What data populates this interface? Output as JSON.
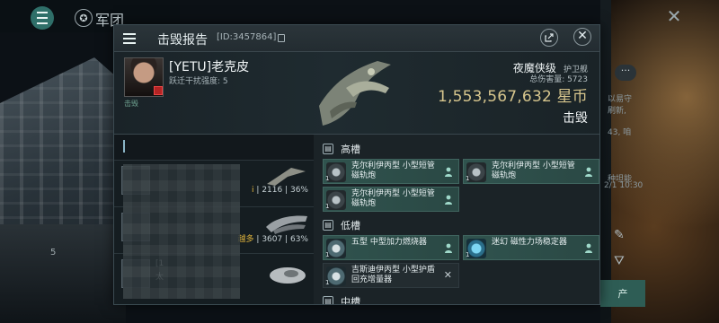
{
  "topbar": {
    "legion_badge": "✪",
    "legion_label": "军团"
  },
  "background": {
    "close_symbol": "✕",
    "more_symbol": "···",
    "right_frag_1": "以易守",
    "right_frag_2": "刷新,",
    "right_frag_3": "43, 咱",
    "right_frag_4": "种坦能",
    "right_frag_5": "2/1 10:30",
    "bottom_button": "产",
    "edit_icon": "✎",
    "filter_icon": "⛛",
    "left_chip": "5"
  },
  "dialog": {
    "title": "击毁报告",
    "report_id": "[ID:3457864]",
    "close_symbol": "✕"
  },
  "victim": {
    "pilot_name": "[YETU]老克皮",
    "pilot_sub": "跃迁干扰强度: 5",
    "pilot_tag": "击毁",
    "ship_class": "夜魔侠级",
    "ship_class_tag": "护卫舰",
    "total_damage": "总伤害量: 5723",
    "isk_value": "1,553,567,632",
    "isk_unit": "星币",
    "kill_state": "击毁"
  },
  "attackers": [
    {
      "name": "",
      "stat_prefix": "i",
      "stat_damage": "2116",
      "stat_percent": "36%"
    },
    {
      "name": "",
      "stat_prefix": "越多",
      "stat_damage": "3607",
      "stat_percent": "63%"
    },
    {
      "name": "[1",
      "name2": "太",
      "stat_prefix": "",
      "stat_damage": "",
      "stat_percent": ""
    }
  ],
  "fitting": {
    "high_slot_label": "高槽",
    "low_slot_label": "低槽",
    "next_slot_label": "中槽",
    "high_modules": [
      {
        "qty": "1",
        "name": "克尔利伊丙型 小型短管磁轨炮"
      },
      {
        "qty": "1",
        "name": "克尔利伊丙型 小型短管磁轨炮"
      },
      {
        "qty": "1",
        "name": "克尔利伊丙型 小型短管磁轨炮"
      }
    ],
    "low_modules": [
      {
        "qty": "1",
        "name": "五型 中型加力燃烧器"
      },
      {
        "qty": "1",
        "name": "迷幻 磁性力场稳定器"
      },
      {
        "qty": "1",
        "name": "吉斯迪伊丙型 小型护盾回充增量器"
      }
    ]
  },
  "colors": {
    "accent_teal": "#30534e",
    "isk_gold": "#d6c58d",
    "warning_red": "#b42424",
    "stat_gold": "#e0b43c"
  },
  "icons": [
    "menu-icon",
    "legion-icon",
    "copy-icon",
    "share-icon",
    "close-icon",
    "pilot-person-icon",
    "module-icon"
  ]
}
